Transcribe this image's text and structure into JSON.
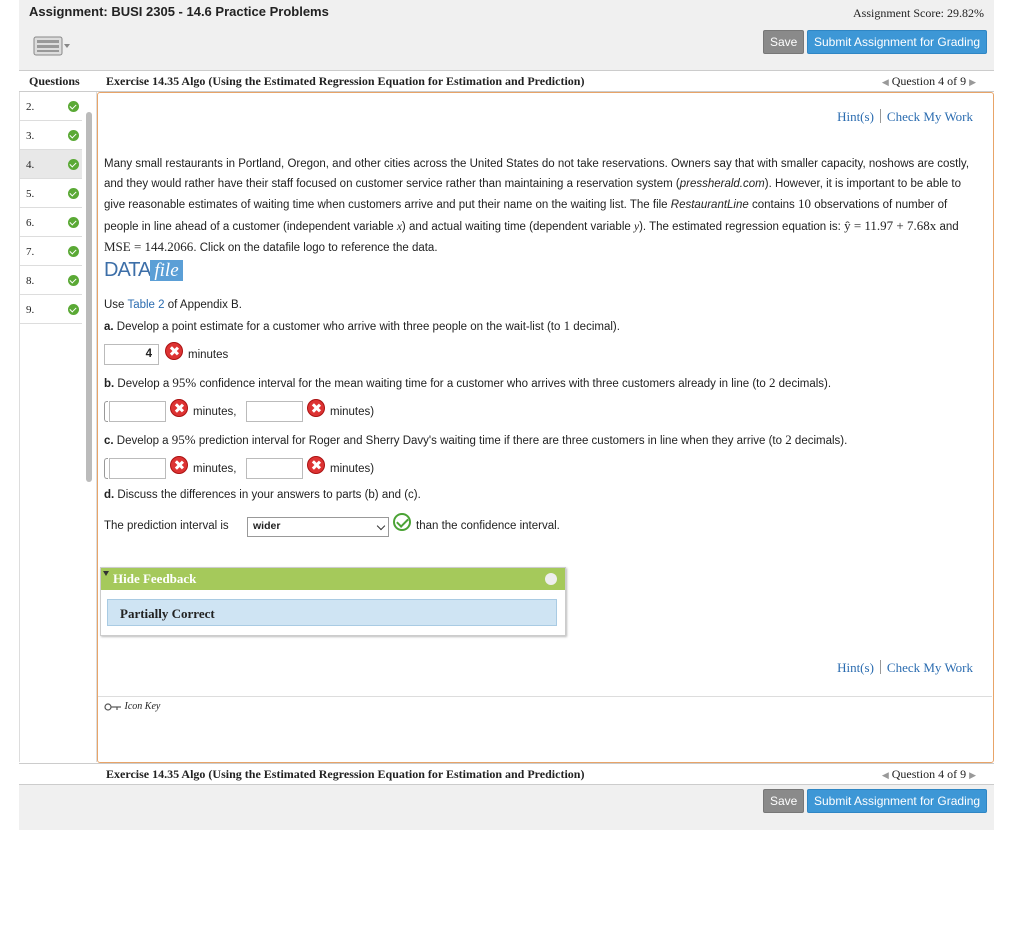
{
  "header": {
    "assignment_title": "Assignment: BUSI 2305 - 14.6 Practice Problems",
    "assignment_score": "Assignment Score: 29.82%",
    "save_label": "Save",
    "submit_label": "Submit Assignment for Grading"
  },
  "nav": {
    "questions_label": "Questions",
    "exercise_title": "Exercise 14.35 Algo (Using the Estimated Regression Equation for Estimation and Prediction)",
    "question_position": "Question 4 of 9"
  },
  "sidebar": {
    "items": [
      {
        "label": "2."
      },
      {
        "label": "3."
      },
      {
        "label": "4."
      },
      {
        "label": "5."
      },
      {
        "label": "6."
      },
      {
        "label": "7."
      },
      {
        "label": "8."
      },
      {
        "label": "9."
      }
    ]
  },
  "links": {
    "hints": "Hint(s)",
    "check": "Check My Work"
  },
  "problem": {
    "intro_1": "Many small restaurants in Portland, Oregon, and other cities across the United States do not take reservations. Owners say that with smaller capacity, noshows are costly, and they would rather have their staff focused on customer service rather than maintaining a reservation system (",
    "source": "pressherald.com",
    "intro_2": "). However, it is important to be able to give reasonable estimates of waiting time when customers arrive and put their name on the waiting list. The file ",
    "file_name": "RestaurantLine",
    "intro_3": " contains ",
    "obs": "10",
    "intro_4": " observations of number of people in line ahead of a customer (independent variable ",
    "var_x": "x",
    "intro_5": ") and actual waiting time (dependent variable ",
    "var_y": "y",
    "intro_6": "). The estimated regression equation is: ",
    "equation": "ŷ = 11.97 + 7.68x",
    "intro_7": " and ",
    "mse": "MSE = 144.2066",
    "intro_8": ". Click on the datafile logo to reference the data.",
    "datafile_a": "DATA",
    "datafile_b": "file",
    "use_a": "Use ",
    "table_link": "Table 2",
    "use_b": " of Appendix B.",
    "part_a_label": "a.",
    "part_a_text": " Develop a point estimate for a customer who arrive with three people on the wait-list (to ",
    "part_a_digits": "1",
    "part_a_end": " decimal).",
    "part_a_value": "4",
    "minutes": "minutes",
    "minutes_comma": "minutes,",
    "minutes_paren": "minutes)",
    "part_b_label": "b.",
    "part_b_text": " Develop a ",
    "part_b_pct": "95%",
    "part_b_rest": " confidence interval for the mean waiting time for a customer who arrives with three customers already in line (to ",
    "part_b_digits": "2",
    "part_b_end": " decimals).",
    "part_c_label": "c.",
    "part_c_text": " Develop a ",
    "part_c_pct": "95%",
    "part_c_rest": " prediction interval for Roger and Sherry Davy's waiting time if there are three customers in line when they arrive (to ",
    "part_c_digits": "2",
    "part_c_end": " decimals).",
    "part_d_label": "d.",
    "part_d_text": " Discuss the differences in your answers to parts (b) and (c).",
    "pred_a": "The prediction interval is",
    "select_value": "wider",
    "pred_b": "than the confidence interval."
  },
  "feedback": {
    "hide_label": "Hide Feedback",
    "status": "Partially Correct"
  },
  "icon_key": "Icon Key",
  "colors": {
    "accent": "#3d97d6",
    "correct": "#5aa935",
    "incorrect": "#d33333",
    "frame": "#e8a468"
  }
}
